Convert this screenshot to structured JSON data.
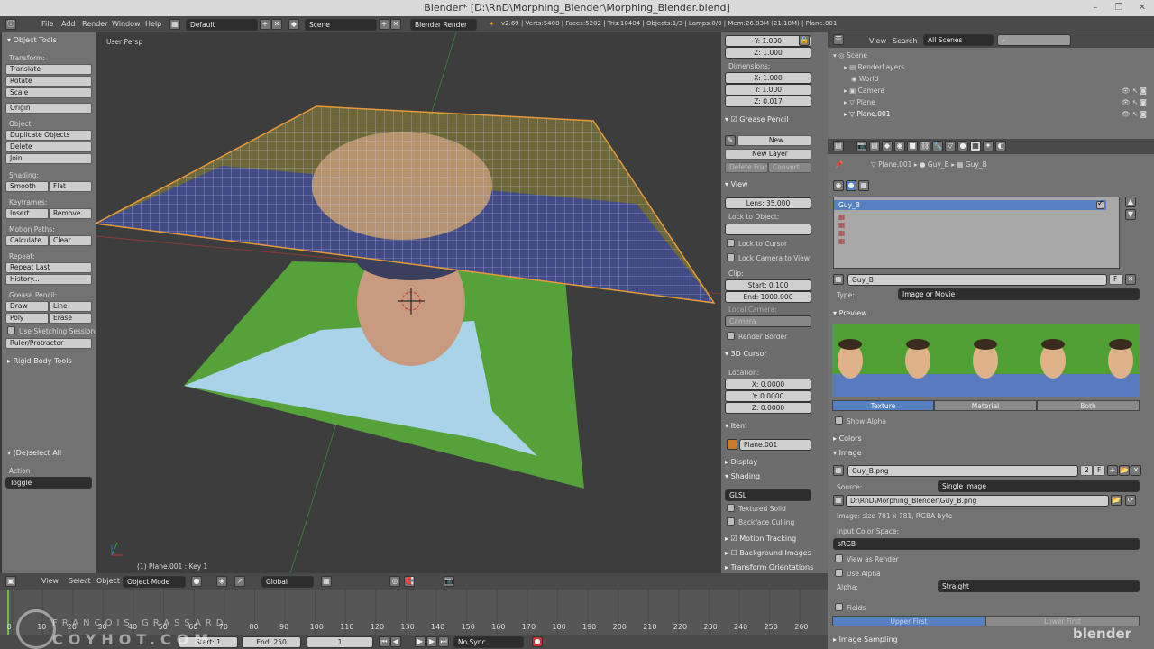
{
  "titlebar": {
    "title": "Blender* [D:\\RnD\\Morphing_Blender\\Morphing_Blender.blend]",
    "minimize": "–",
    "maximize": "❐",
    "close": "✕"
  },
  "menubar": {
    "menus": [
      "File",
      "Add",
      "Render",
      "Window",
      "Help"
    ],
    "layout": "Default",
    "scene": "Scene",
    "engine": "Blender Render",
    "stats": "v2.69 | Verts:5408 | Faces:5202 | Tris:10404 | Objects:1/3 | Lamps:0/0 | Mem:26.83M (21.18M) | Plane.001"
  },
  "toolshelf": {
    "title": "Object Tools",
    "sections": {
      "transform": "Transform:",
      "object": "Object:",
      "shading": "Shading:",
      "keyframes": "Keyframes:",
      "motion": "Motion Paths:",
      "repeat": "Repeat:",
      "grease": "Grease Pencil:"
    },
    "buttons": {
      "translate": "Translate",
      "rotate": "Rotate",
      "scale": "Scale",
      "origin": "Origin",
      "duplicate": "Duplicate Objects",
      "delete": "Delete",
      "join": "Join",
      "smooth": "Smooth",
      "flat": "Flat",
      "insert": "Insert",
      "remove": "Remove",
      "calculate": "Calculate",
      "clear": "Clear",
      "repeat_last": "Repeat Last",
      "history": "History...",
      "draw": "Draw",
      "line": "Line",
      "poly": "Poly",
      "erase": "Erase",
      "ruler": "Ruler/Protractor"
    },
    "sketch": "Use Sketching Sessions",
    "rigid": "Rigid Body Tools",
    "op_title": "(De)select All",
    "action_label": "Action",
    "action_value": "Toggle"
  },
  "viewport": {
    "label": "User Persp",
    "status": "(1) Plane.001 : Key 1"
  },
  "npanel": {
    "scale_y": "Y: 1.000",
    "scale_z": "Z: 1.000",
    "dimensions": "Dimensions:",
    "dim_x": "X: 1.000",
    "dim_y": "Y: 1.000",
    "dim_z": "Z: 0.017",
    "grease": "Grease Pencil",
    "new": "New",
    "new_layer": "New Layer",
    "delete_frame": "Delete Frame",
    "convert": "Convert",
    "view": "View",
    "lens": "Lens: 35.000",
    "lock_obj": "Lock to Object:",
    "lock_cursor": "Lock to Cursor",
    "lock_camera": "Lock Camera to View",
    "clip": "Clip:",
    "start": "Start: 0.100",
    "end": "End: 1000.000",
    "local_camera": "Local Camera:",
    "camera": "Camera",
    "render_border": "Render Border",
    "cursor": "3D Cursor",
    "location": "Location:",
    "cx": "X: 0.0000",
    "cy": "Y: 0.0000",
    "cz": "Z: 0.0000",
    "item": "Item",
    "item_name": "Plane.001",
    "display": "Display",
    "shading": "Shading",
    "glsl": "GLSL",
    "textured_solid": "Textured Solid",
    "backface": "Backface Culling",
    "motion_tracking": "Motion Tracking",
    "background_images": "Background Images",
    "transform_orient": "Transform Orientations"
  },
  "outliner": {
    "view": "View",
    "search": "Search",
    "filter": "All Scenes",
    "items": [
      "Scene",
      "RenderLayers",
      "World",
      "Camera",
      "Plane",
      "Plane.001"
    ]
  },
  "properties": {
    "breadcrumb": [
      "Plane.001",
      "Guy_B",
      "Guy_B"
    ],
    "slots": [
      "Guy_B"
    ],
    "tex_name": "Guy_B",
    "tex_f": "F",
    "type_label": "Type:",
    "type_value": "Image or Movie",
    "preview": "Preview",
    "tabs": [
      "Texture",
      "Material",
      "Both"
    ],
    "show_alpha": "Show Alpha",
    "colors": "Colors",
    "image": "Image",
    "img_name": "Guy_B.png",
    "img_users": "2",
    "img_f": "F",
    "source_label": "Source:",
    "source_value": "Single Image",
    "path": "D:\\RnD\\Morphing_Blender\\Guy_B.png",
    "img_info": "Image: size 781 x 781, RGBA byte",
    "colorspace_label": "Input Color Space:",
    "colorspace": "sRGB",
    "view_as_render": "View as Render",
    "use_alpha": "Use Alpha",
    "alpha_label": "Alpha:",
    "alpha_value": "Straight",
    "fields": "Fields",
    "upper_first": "Upper First",
    "lower_first": "Lower First",
    "image_sampling": "Image Sampling"
  },
  "view3d_header": {
    "view": "View",
    "select": "Select",
    "object": "Object",
    "mode": "Object Mode",
    "orientation": "Global"
  },
  "timeline": {
    "ticks": [
      "-10",
      "0",
      "10",
      "20",
      "30",
      "40",
      "50",
      "60",
      "70",
      "80",
      "90",
      "100",
      "110",
      "120",
      "130",
      "140",
      "150",
      "160",
      "170",
      "180",
      "190",
      "200",
      "210",
      "220",
      "230",
      "240",
      "250",
      "260"
    ],
    "start": "Start: 1",
    "end": "End: 250",
    "current": "1",
    "sync": "No Sync"
  },
  "watermark": {
    "top": "FRANCOIS GRASSARD",
    "bottom": "COYHOT.COM",
    "logo": "blender"
  },
  "colors": {
    "accent": "#5680c2",
    "viewport": "#3d3d3d",
    "panel": "#727272"
  }
}
